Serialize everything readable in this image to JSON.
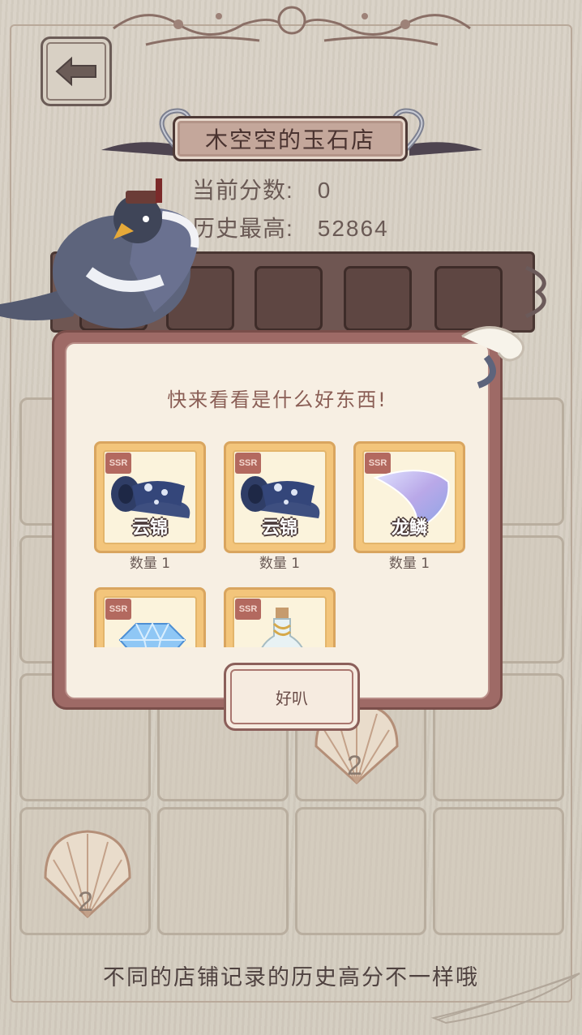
{
  "shop": {
    "title": "木空空的玉石店"
  },
  "score": {
    "current_label": "当前分数:",
    "current_value": "0",
    "best_label": "历史最高:",
    "best_value": "52864"
  },
  "modal": {
    "heading": "快来看看是什么好东西!",
    "items": [
      {
        "rarity": "SSR",
        "name": "云锦",
        "qty": "数量 1",
        "art": "cloud-brocade-roll"
      },
      {
        "rarity": "SSR",
        "name": "云锦",
        "qty": "数量 1",
        "art": "cloud-brocade-roll"
      },
      {
        "rarity": "SSR",
        "name": "龙鳞",
        "qty": "数量 1",
        "art": "dragon-scale"
      },
      {
        "rarity": "SSR",
        "name": "",
        "qty": "",
        "art": "blue-diamond"
      },
      {
        "rarity": "SSR",
        "name": "",
        "qty": "",
        "art": "glass-bottle"
      }
    ],
    "ok_label": "好叭"
  },
  "board": {
    "tiles": [
      {
        "value": "2",
        "icon": "scallop-shell"
      },
      {
        "value": "2",
        "icon": "scallop-shell"
      }
    ]
  },
  "footer": {
    "tip": "不同的店铺记录的历史高分不一样哦"
  },
  "colors": {
    "background": "#d9d2c6",
    "modal_frame": "#9e6a66",
    "modal_paper": "#f7efe3",
    "item_gold": "#f3c57b",
    "ssr_badge": "#b3695f"
  }
}
